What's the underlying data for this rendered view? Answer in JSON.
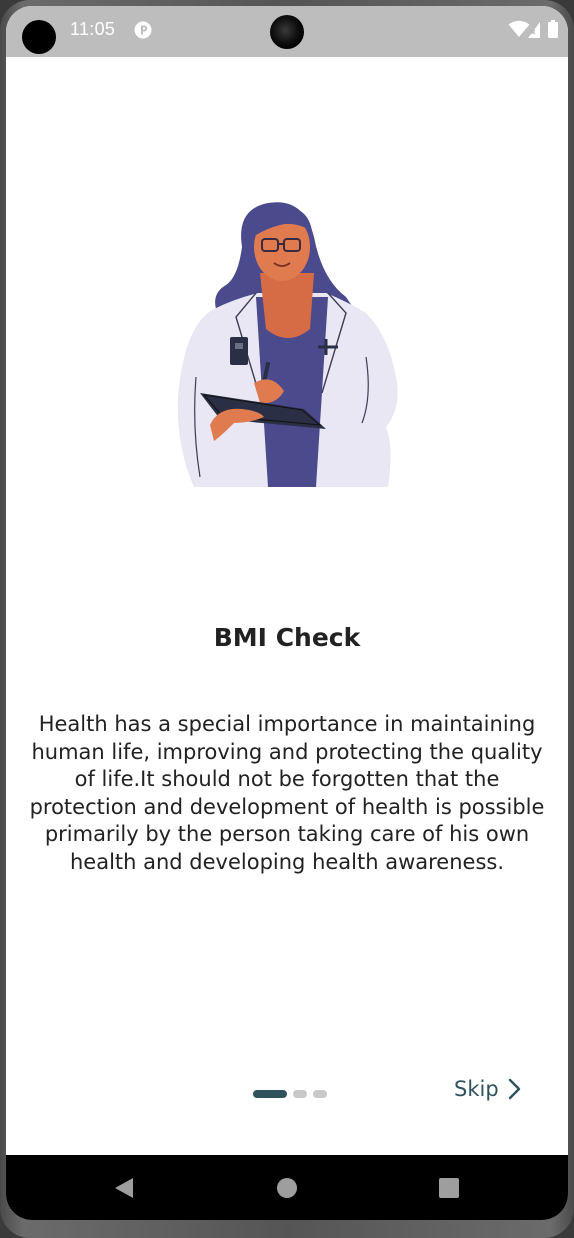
{
  "status_bar": {
    "time": "11:05",
    "icons": [
      "camera-icon",
      "app-notification-icon",
      "wifi-icon",
      "cell-signal-icon",
      "battery-icon"
    ]
  },
  "onboarding": {
    "illustration": "doctor-with-clipboard-illustration",
    "title": "BMI Check",
    "description": "Health has a special importance in maintaining human life, improving and protecting the quality of life.It should not be forgotten that the protection and development of health is possible primarily by the person taking care of his own health and developing health awareness.",
    "page_indicator": {
      "current_page": 1,
      "total_pages": 3
    },
    "skip_label": "Skip"
  },
  "navigation_bar": {
    "buttons": [
      "back-icon",
      "home-icon",
      "recents-icon"
    ]
  },
  "colors": {
    "accent": "#2e535d",
    "inactive_dot": "#c8c8c8",
    "status_bar_bg": "#bdbdbd",
    "nav_bar_bg": "#000000",
    "illustration_hair": "#4b4a8c",
    "illustration_skin": "#e07b4f",
    "illustration_coat": "#e8e7f3"
  }
}
